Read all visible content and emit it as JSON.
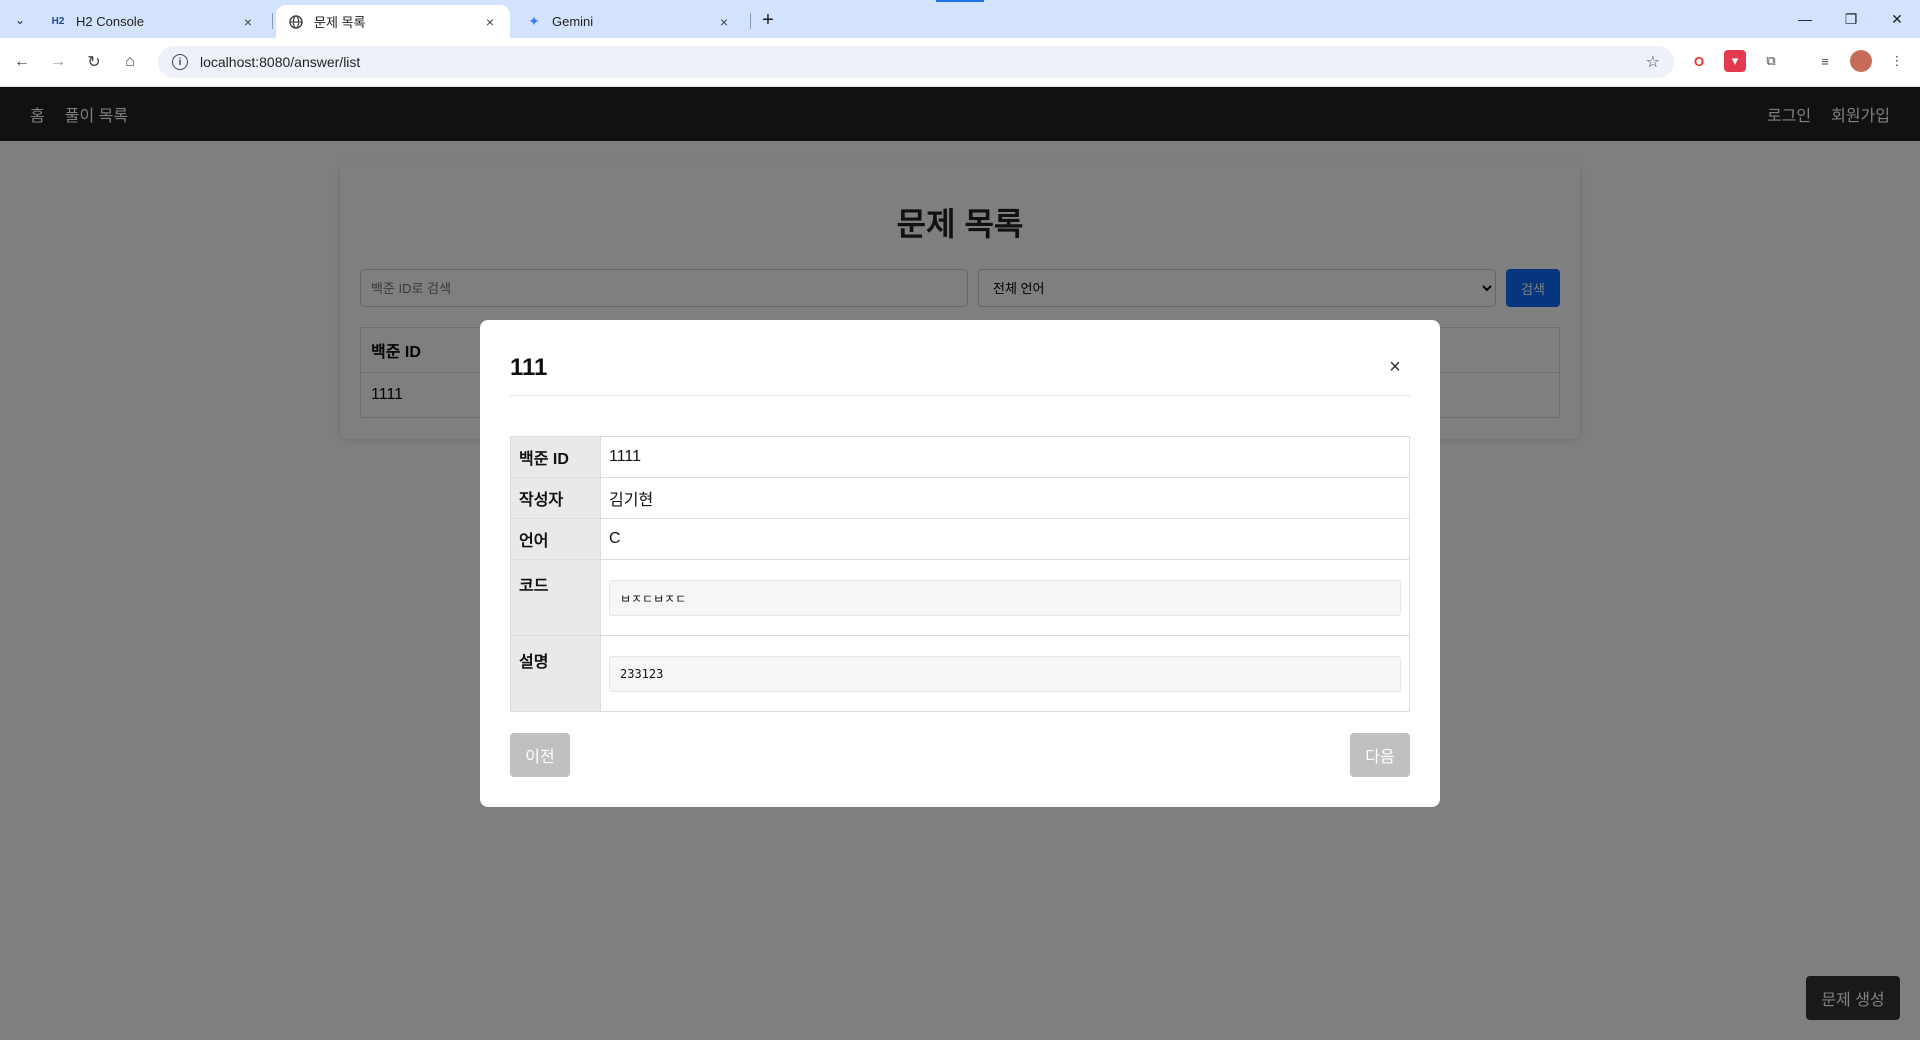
{
  "browser": {
    "tabs": [
      {
        "title": "H2 Console",
        "icon": "h2-icon"
      },
      {
        "title": "문제 목록",
        "icon": "globe-icon"
      },
      {
        "title": "Gemini",
        "icon": "gemini-icon"
      }
    ],
    "url": "localhost:8080/answer/list"
  },
  "nav": {
    "home": "홈",
    "solutions": "풀이 목록",
    "login": "로그인",
    "signup": "회원가입"
  },
  "main": {
    "title": "문제 목록",
    "search_placeholder": "백준 ID로 검색",
    "language_select": "전체 언어",
    "search_button": "검색",
    "table_header": "백준 ID",
    "rows": [
      {
        "id": "1111"
      }
    ]
  },
  "fab_label": "문제 생성",
  "modal": {
    "title": "111",
    "fields": {
      "baekjoon_id_label": "백준 ID",
      "baekjoon_id": "1111",
      "author_label": "작성자",
      "author": "김기현",
      "language_label": "언어",
      "language": "C",
      "code_label": "코드",
      "code": "ㅂㅈㄷㅂㅈㄷ",
      "description_label": "설명",
      "description": "233123"
    },
    "prev_button": "이전",
    "next_button": "다음"
  },
  "colors": {
    "navbar": "#222222",
    "primary": "#0d6efd",
    "disabled_button": "#c0c0c0"
  }
}
